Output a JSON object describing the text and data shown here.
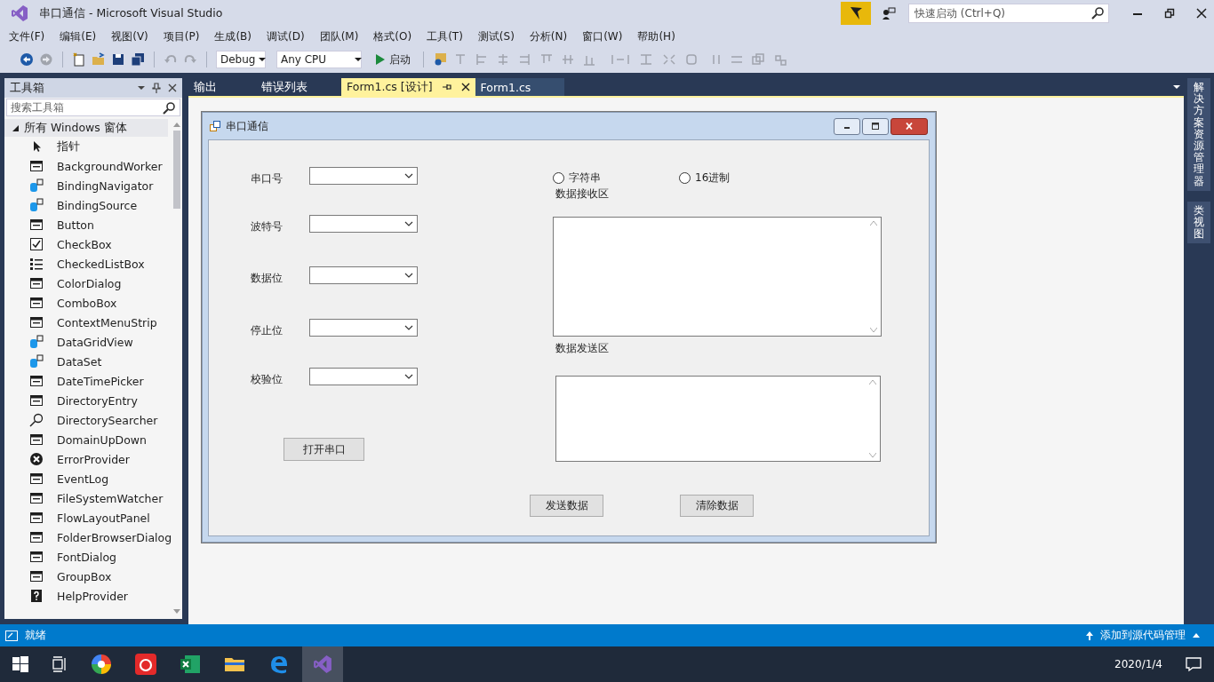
{
  "window": {
    "title": "串口通信 - Microsoft Visual Studio"
  },
  "quick_launch": {
    "placeholder": "快速启动 (Ctrl+Q)"
  },
  "menu": [
    "文件(F)",
    "编辑(E)",
    "视图(V)",
    "项目(P)",
    "生成(B)",
    "调试(D)",
    "团队(M)",
    "格式(O)",
    "工具(T)",
    "测试(S)",
    "分析(N)",
    "窗口(W)",
    "帮助(H)"
  ],
  "toolbar": {
    "configuration": "Debug",
    "platform": "Any CPU",
    "start": "启动"
  },
  "toolbox": {
    "title": "工具箱",
    "search": {
      "placeholder": "搜索工具箱"
    },
    "group": {
      "label": "所有 Windows 窗体",
      "expanded": true,
      "items": [
        {
          "label": "指针",
          "kind": "pointer"
        },
        {
          "label": "BackgroundWorker",
          "kind": "component"
        },
        {
          "label": "BindingNavigator",
          "kind": "data"
        },
        {
          "label": "BindingSource",
          "kind": "data"
        },
        {
          "label": "Button",
          "kind": "component"
        },
        {
          "label": "CheckBox",
          "kind": "check"
        },
        {
          "label": "CheckedListBox",
          "kind": "list"
        },
        {
          "label": "ColorDialog",
          "kind": "component"
        },
        {
          "label": "ComboBox",
          "kind": "component"
        },
        {
          "label": "ContextMenuStrip",
          "kind": "component"
        },
        {
          "label": "DataGridView",
          "kind": "data"
        },
        {
          "label": "DataSet",
          "kind": "data"
        },
        {
          "label": "DateTimePicker",
          "kind": "component"
        },
        {
          "label": "DirectoryEntry",
          "kind": "component"
        },
        {
          "label": "DirectorySearcher",
          "kind": "search"
        },
        {
          "label": "DomainUpDown",
          "kind": "component"
        },
        {
          "label": "ErrorProvider",
          "kind": "error"
        },
        {
          "label": "EventLog",
          "kind": "component"
        },
        {
          "label": "FileSystemWatcher",
          "kind": "component"
        },
        {
          "label": "FlowLayoutPanel",
          "kind": "component"
        },
        {
          "label": "FolderBrowserDialog",
          "kind": "component"
        },
        {
          "label": "FontDialog",
          "kind": "component"
        },
        {
          "label": "GroupBox",
          "kind": "component"
        },
        {
          "label": "HelpProvider",
          "kind": "help"
        }
      ]
    }
  },
  "doc_tabs": [
    {
      "label": "输出",
      "selected": false
    },
    {
      "label": "错误列表",
      "selected": false
    },
    {
      "label": "Form1.cs [设计]",
      "selected": true
    },
    {
      "label": "Form1.cs",
      "selected": false
    }
  ],
  "form": {
    "title": "串口通信",
    "fields": [
      {
        "label": "串口号"
      },
      {
        "label": "波特号"
      },
      {
        "label": "数据位"
      },
      {
        "label": "停止位"
      },
      {
        "label": "校验位"
      }
    ],
    "open_button": "打开串口",
    "radios": [
      {
        "label": "字符串",
        "selected": false
      },
      {
        "label": "16进制",
        "selected": false
      }
    ],
    "receive_label": "数据接收区",
    "send_label": "数据发送区",
    "buttons": [
      "发送数据",
      "清除数据"
    ]
  },
  "side_tabs": [
    "解决方案资源管理器",
    "类视图"
  ],
  "status_bar": {
    "text": "就绪",
    "action": "添加到源代码管理"
  },
  "taskbar": {
    "date": "2020/1/4"
  }
}
